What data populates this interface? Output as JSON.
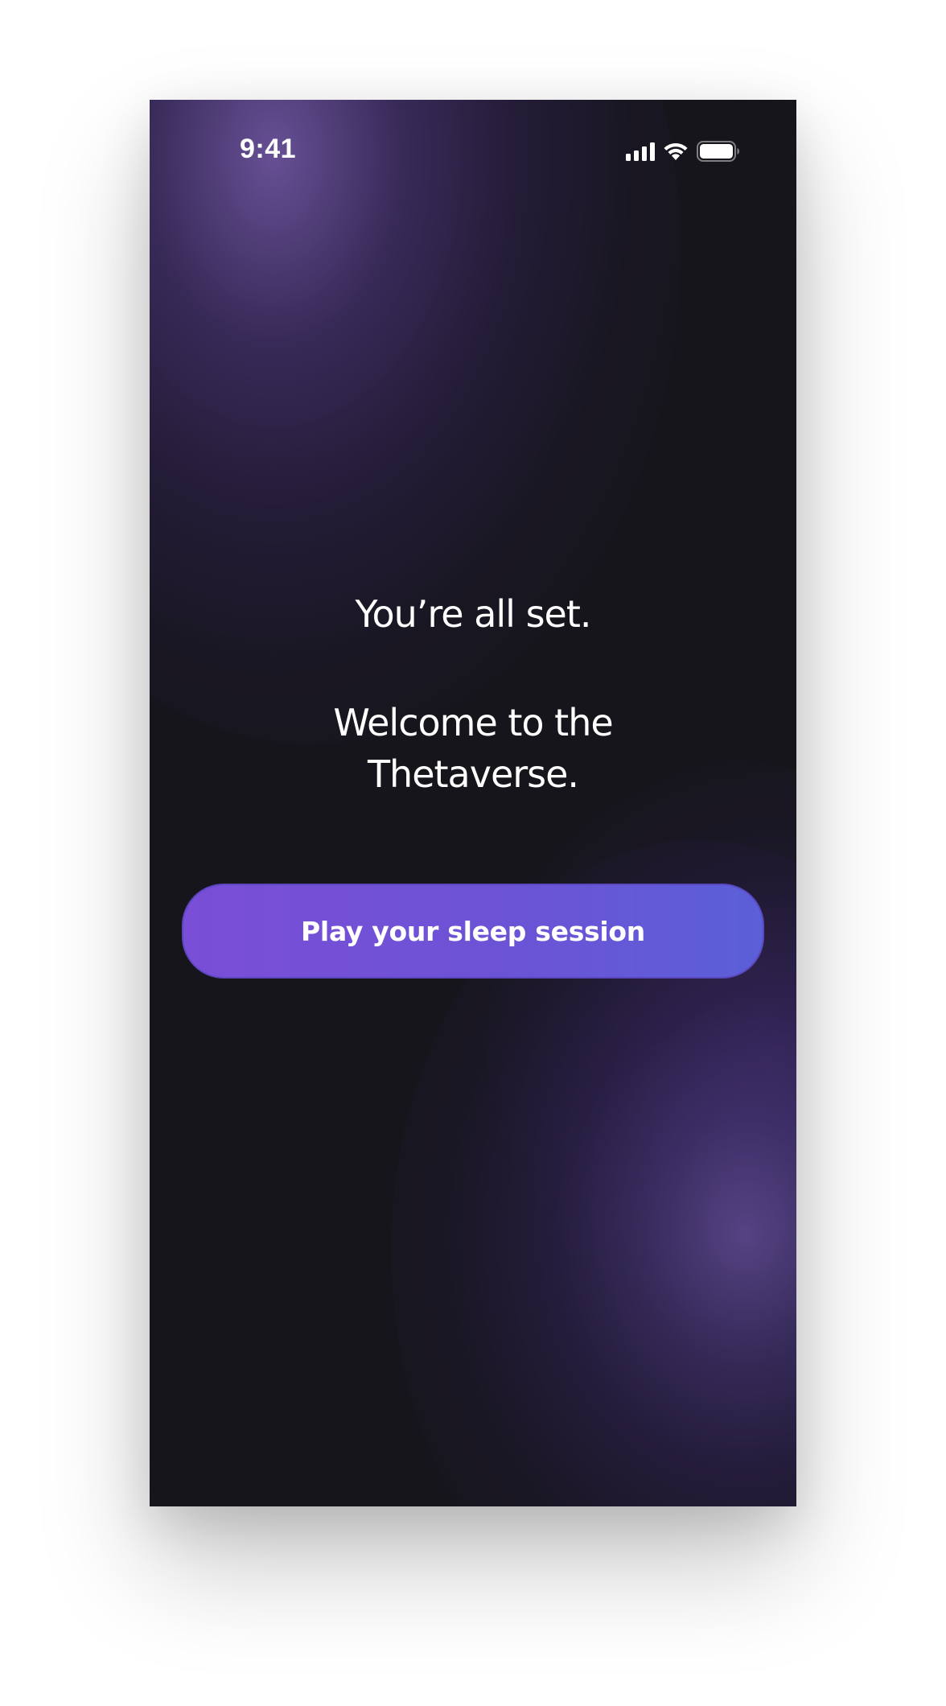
{
  "status_bar": {
    "time": "9:41",
    "icons": [
      "cellular-signal-icon",
      "wifi-icon",
      "battery-icon"
    ]
  },
  "main": {
    "headline": "You’re all set.",
    "welcome_line_1": "Welcome to the",
    "welcome_line_2": "Thetaverse."
  },
  "cta": {
    "label": "Play your sleep session"
  },
  "colors": {
    "background": "#16151b",
    "glow": "#6b4fa8",
    "button_start": "#7a4ed6",
    "button_end": "#5b5fd8",
    "text": "#ffffff"
  }
}
